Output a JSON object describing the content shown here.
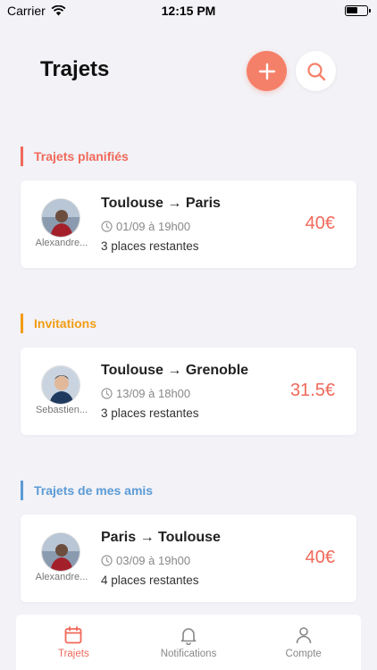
{
  "status_bar": {
    "carrier": "Carrier",
    "time": "12:15 PM",
    "battery_level": 0.55
  },
  "header": {
    "title": "Trajets"
  },
  "colors": {
    "accent": "#f58069",
    "price": "#f0695a",
    "planned": "#f0695a",
    "invitations": "#f39c12",
    "friends": "#5b9bd5",
    "tab_active": "#f0695a",
    "tab_inactive": "#888888"
  },
  "sections": [
    {
      "title": "Trajets planifiés",
      "card": {
        "driver": "Alexandre...",
        "route": "Toulouse → Paris",
        "date": "01/09 à 19h00",
        "seats": "3 places restantes",
        "price": "40€"
      }
    },
    {
      "title": "Invitations",
      "card": {
        "driver": "Sebastien...",
        "route": "Toulouse → Grenoble",
        "date": "13/09 à 18h00",
        "seats": "3 places restantes",
        "price": "31.5€"
      }
    },
    {
      "title": "Trajets de mes amis",
      "card": {
        "driver": "Alexandre...",
        "route": "Paris → Toulouse",
        "date": "03/09 à 19h00",
        "seats": "4 places restantes",
        "price": "40€"
      }
    }
  ],
  "tabs": [
    {
      "label": "Trajets",
      "icon": "calendar-icon",
      "active": true
    },
    {
      "label": "Notifications",
      "icon": "bell-icon",
      "active": false
    },
    {
      "label": "Compte",
      "icon": "user-icon",
      "active": false
    }
  ]
}
